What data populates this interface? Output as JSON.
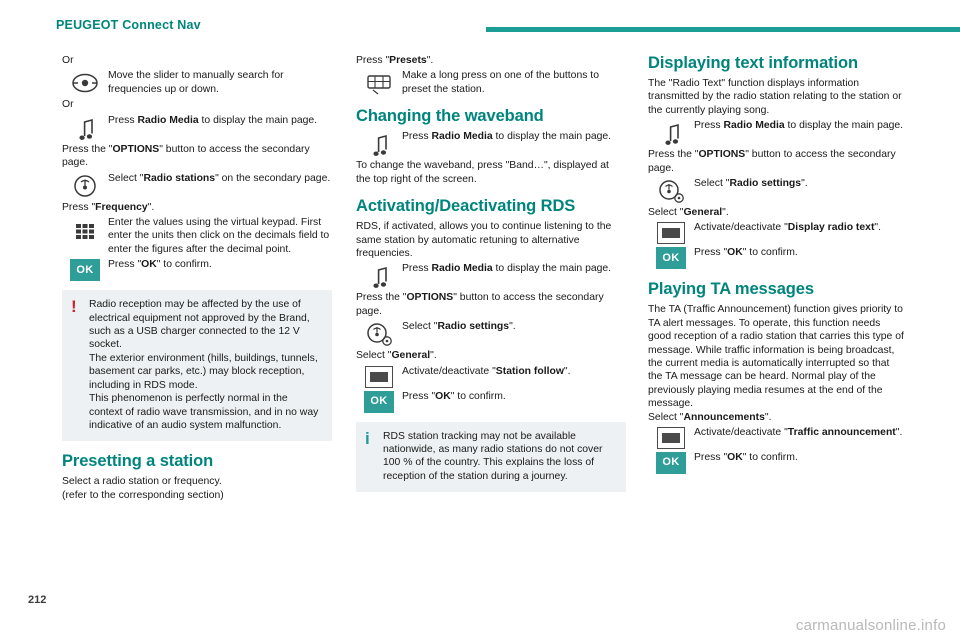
{
  "header": {
    "brand": "PEUGEOT Connect Nav"
  },
  "footer": {
    "page_number": "212",
    "watermark": "carmanualsonline.info"
  },
  "column1": {
    "or_1": "Or",
    "slider_text": "Move the slider to manually search for frequencies up or down.",
    "or_2": "Or",
    "radio_media_text_1": "Press ",
    "radio_media_bold_1": "Radio Media",
    "radio_media_text_1b": " to display the main page.",
    "options_line_a": "Press the \"",
    "options_bold": "OPTIONS",
    "options_line_b": "\" button to access the secondary page.",
    "select_radio_stations_a": "Select \"",
    "select_radio_stations_bold": "Radio stations",
    "select_radio_stations_b": "\" on the secondary page.",
    "press_frequency_a": "Press \"",
    "press_frequency_bold": "Frequency",
    "press_frequency_b": "\".",
    "keypad_text": "Enter the values using the virtual keypad. First enter the units then click on the decimals field to enter the figures after the decimal point.",
    "press_ok_a": "Press \"",
    "press_ok_bold": "OK",
    "press_ok_b": "\" to confirm.",
    "warning_note_line1": "Radio reception may be affected by the use of electrical equipment not approved by the Brand, such as a USB charger connected to the 12 V socket.",
    "warning_note_line2": "The exterior environment (hills, buildings, tunnels, basement car parks, etc.) may block reception, including in RDS mode.",
    "warning_note_line3": "This phenomenon is perfectly normal in the context of radio wave transmission, and in no way indicative of an audio system malfunction.",
    "heading_presetting": "Presetting a station",
    "presetting_line1": "Select a radio station or frequency.",
    "presetting_line2": "(refer to the corresponding section)"
  },
  "column2": {
    "press_presets_a": "Press \"",
    "press_presets_bold": "Presets",
    "press_presets_b": "\".",
    "long_press_text": "Make a long press on one of the buttons to preset the station.",
    "heading_waveband": "Changing the waveband",
    "radio_media_text": "Press ",
    "radio_media_bold": "Radio Media",
    "radio_media_text_b": " to display the main page.",
    "waveband_change_a": "To change the waveband, press \"Band…\", displayed at the top right of the screen.",
    "heading_rds": "Activating/Deactivating RDS",
    "rds_intro": "RDS, if activated, allows you to continue listening to the same station by automatic retuning to alternative frequencies.",
    "options_line_a": "Press the \"",
    "options_bold": "OPTIONS",
    "options_line_b": "\" button to access the secondary page.",
    "select_radio_settings_a": "Select \"",
    "select_radio_settings_bold": "Radio settings",
    "select_radio_settings_b": "\".",
    "select_general_a": "Select \"",
    "select_general_bold": "General",
    "select_general_b": "\".",
    "station_follow_a": "Activate/deactivate \"",
    "station_follow_bold": "Station follow",
    "station_follow_b": "\".",
    "press_ok_a": "Press \"",
    "press_ok_bold": "OK",
    "press_ok_b": "\" to confirm.",
    "info_note": "RDS station tracking may not be available nationwide, as many radio stations do not cover 100 % of the country. This explains the loss of reception of the station during a journey."
  },
  "column3": {
    "heading_text_info": "Displaying text information",
    "text_info_intro": "The \"Radio Text\" function displays information transmitted by the radio station relating to the station or the currently playing song.",
    "radio_media_text": "Press ",
    "radio_media_bold": "Radio Media",
    "radio_media_text_b": " to display the main page.",
    "options_line_a": "Press the \"",
    "options_bold": "OPTIONS",
    "options_line_b": "\" button to access the secondary page.",
    "select_radio_settings_a": "Select \"",
    "select_radio_settings_bold": "Radio settings",
    "select_radio_settings_b": "\".",
    "select_general_a": "Select \"",
    "select_general_bold": "General",
    "select_general_b": "\".",
    "display_radio_text_a": "Activate/deactivate \"",
    "display_radio_text_bold": "Display radio text",
    "display_radio_text_b": "\".",
    "press_ok_a": "Press \"",
    "press_ok_bold": "OK",
    "press_ok_b": "\" to confirm.",
    "heading_ta": "Playing TA messages",
    "ta_intro": "The TA (Traffic Announcement) function gives priority to TA alert messages. To operate, this function needs good reception of a radio station that carries this type of message. While traffic information is being broadcast, the current media is automatically interrupted so that the TA message can be heard. Normal play of the previously playing media resumes at the end of the message.",
    "select_announcements_a": "Select \"",
    "select_announcements_bold": "Announcements",
    "select_announcements_b": "\".",
    "traffic_announcement_a": "Activate/deactivate \"",
    "traffic_announcement_bold": "Traffic announcement",
    "traffic_announcement_b": "\".",
    "press_ok2_a": "Press \"",
    "press_ok2_bold": "OK",
    "press_ok2_b": "\" to confirm."
  },
  "icons": {
    "slider": "radio-slider-icon",
    "note": "music-note-icon",
    "radio_stations": "radio-tower-icon",
    "keypad": "virtual-keypad-icon",
    "ok": "OK",
    "presets": "presets-icon",
    "radio_settings": "radio-settings-icon",
    "toggle": "toggle-box-icon"
  },
  "colors": {
    "accent": "#00857d",
    "rule": "#1c9d96",
    "ok_button": "#2f9e98",
    "warning": "#d0202a",
    "note_bg": "#eef1f3"
  }
}
